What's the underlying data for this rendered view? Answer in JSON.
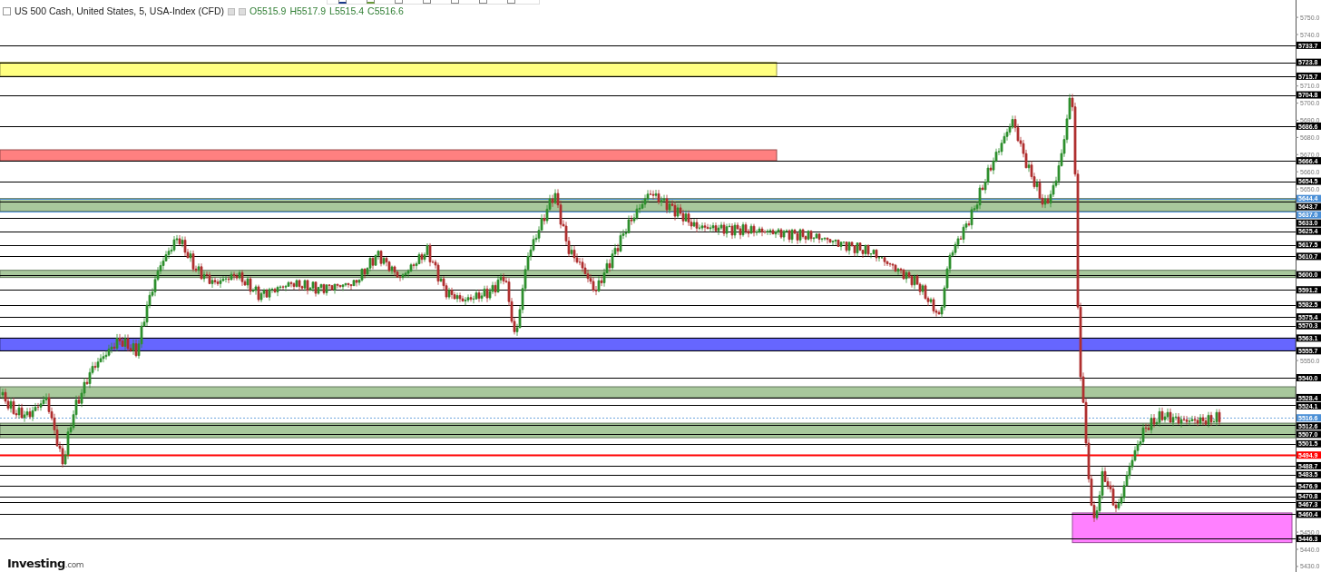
{
  "header": {
    "title": "US 500 Cash, United States, 5, USA-Index (CFD)",
    "open": "O5515.9",
    "high": "H5517.9",
    "low": "L5515.4",
    "close": "C5516.6"
  },
  "axis_ticks": [
    "5750.0",
    "5740.0",
    "5710.0",
    "5700.0",
    "5690.0",
    "5680.0",
    "5670.0",
    "5660.0",
    "5650.0",
    "5550.0",
    "5450.0",
    "5440.0",
    "5430.0"
  ],
  "zones": [
    {
      "color": "#ffff80",
      "kind": "band"
    },
    {
      "color": "#ff8080",
      "kind": "band"
    },
    {
      "color": "#a8c89c",
      "kind": "band"
    },
    {
      "color": "#a8c89c",
      "kind": "band"
    },
    {
      "color": "#6666ff",
      "kind": "band"
    },
    {
      "color": "#a8c89c",
      "kind": "band"
    },
    {
      "color": "#a8c89c",
      "kind": "band"
    },
    {
      "color": "#ff80ff",
      "kind": "box"
    }
  ],
  "levels": [
    {
      "label": "5733.7",
      "color": "#000000",
      "kind": "level"
    },
    {
      "label": "5723.8",
      "color": "#000000",
      "kind": "level"
    },
    {
      "label": "5715.7",
      "color": "#000000",
      "kind": "level"
    },
    {
      "label": "5704.8",
      "color": "#000000",
      "kind": "level"
    },
    {
      "label": "5686.6",
      "color": "#000000",
      "kind": "level"
    },
    {
      "label": "5666.4",
      "color": "#000000",
      "kind": "level"
    },
    {
      "label": "5654.5",
      "color": "#000000",
      "kind": "level"
    },
    {
      "label": "5644.4",
      "color": "#4a8fd6",
      "kind": "level"
    },
    {
      "label": "5643.7",
      "color": "#000000",
      "kind": "level"
    },
    {
      "label": "5637.0",
      "color": "#4a8fd6",
      "kind": "level"
    },
    {
      "label": "5633.0",
      "color": "#000000",
      "kind": "level"
    },
    {
      "label": "5625.4",
      "color": "#000000",
      "kind": "level"
    },
    {
      "label": "5617.5",
      "color": "#000000",
      "kind": "level"
    },
    {
      "label": "5610.7",
      "color": "#000000",
      "kind": "level"
    },
    {
      "label": "5600.0",
      "color": "#000000",
      "kind": "level"
    },
    {
      "label": "5591.2",
      "color": "#000000",
      "kind": "level"
    },
    {
      "label": "5582.5",
      "color": "#000000",
      "kind": "level"
    },
    {
      "label": "5575.4",
      "color": "#000000",
      "kind": "level"
    },
    {
      "label": "5570.3",
      "color": "#000000",
      "kind": "level"
    },
    {
      "label": "5563.1",
      "color": "#000000",
      "kind": "level"
    },
    {
      "label": "5555.7",
      "color": "#000000",
      "kind": "level"
    },
    {
      "label": "5540.0",
      "color": "#000000",
      "kind": "level"
    },
    {
      "label": "5528.4",
      "color": "#000000",
      "kind": "level"
    },
    {
      "label": "5524.1",
      "color": "#000000",
      "kind": "level"
    },
    {
      "label": "5516.6",
      "color": "#4a8fd6",
      "kind": "current"
    },
    {
      "label": "5512.6",
      "color": "#000000",
      "kind": "level"
    },
    {
      "label": "5507.0",
      "color": "#000000",
      "kind": "level"
    },
    {
      "label": "5501.5",
      "color": "#000000",
      "kind": "level"
    },
    {
      "label": "5494.9",
      "color": "#ff0000",
      "kind": "level"
    },
    {
      "label": "5488.7",
      "color": "#000000",
      "kind": "level"
    },
    {
      "label": "5483.5",
      "color": "#000000",
      "kind": "level"
    },
    {
      "label": "5476.9",
      "color": "#000000",
      "kind": "level"
    },
    {
      "label": "5470.8",
      "color": "#000000",
      "kind": "level"
    },
    {
      "label": "5467.3",
      "color": "#000000",
      "kind": "level"
    },
    {
      "label": "5460.4",
      "color": "#000000",
      "kind": "level"
    },
    {
      "label": "5446.3",
      "color": "#000000",
      "kind": "level"
    }
  ],
  "logo": {
    "name": "Investing",
    "suffix": ".com"
  }
}
